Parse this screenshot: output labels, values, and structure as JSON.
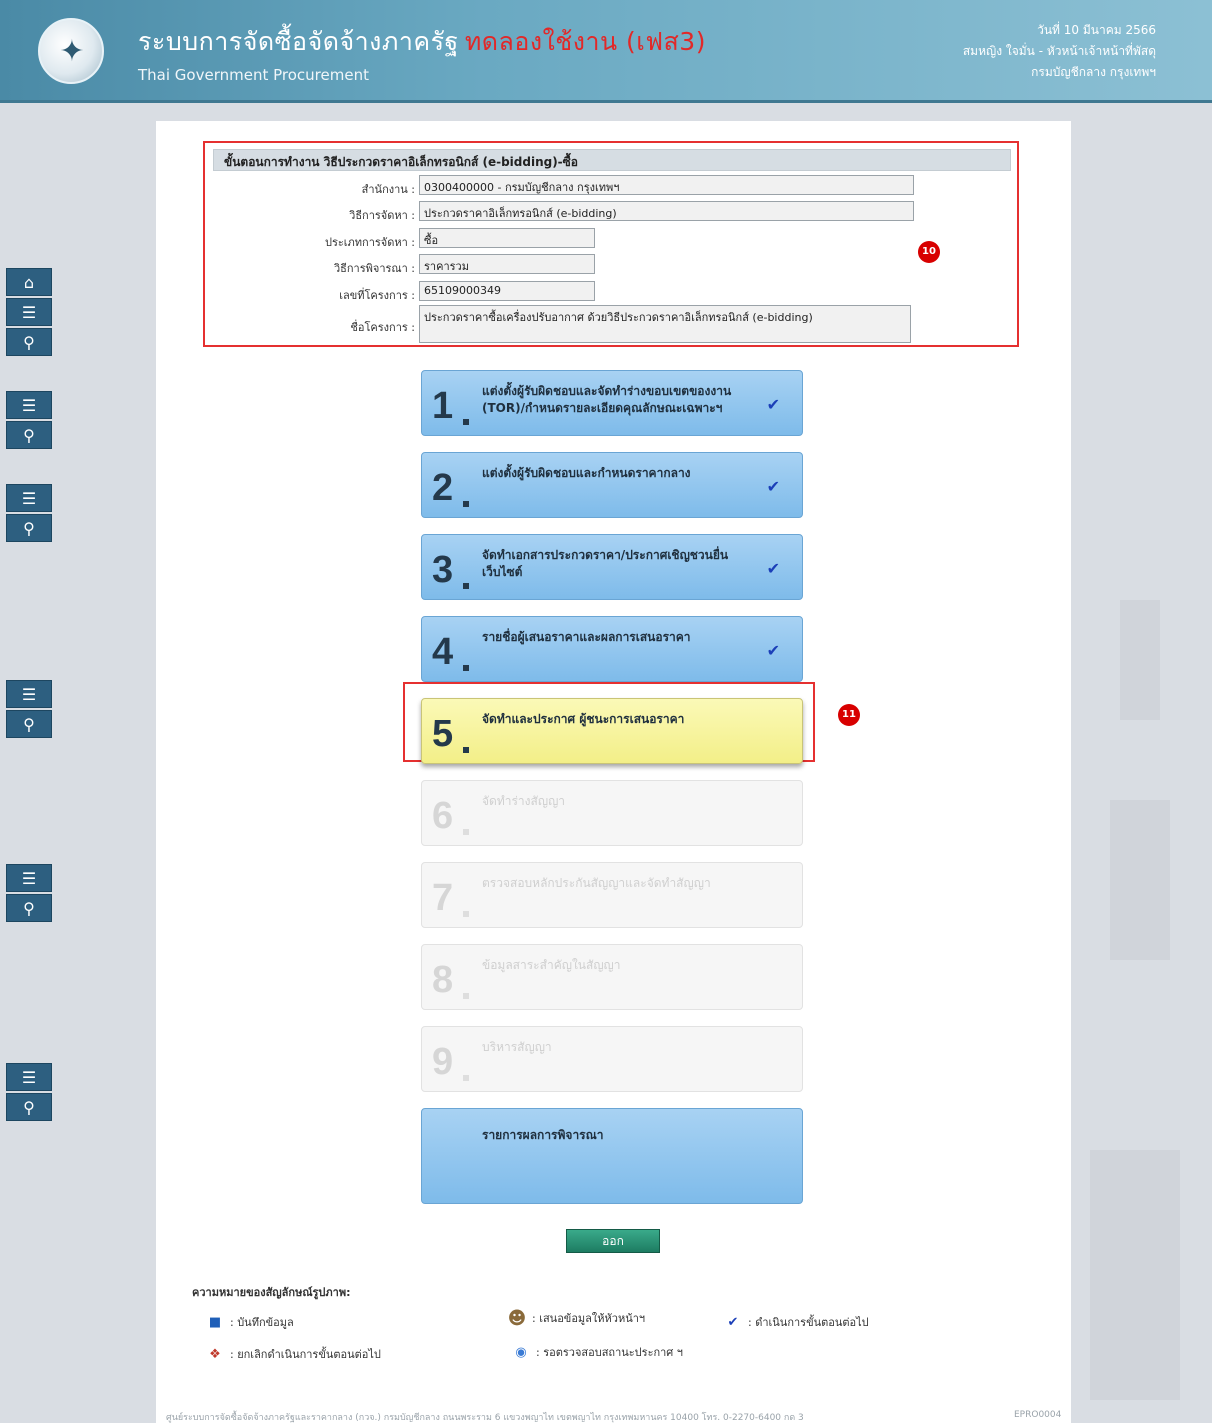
{
  "header": {
    "title": "ระบบการจัดซื้อจัดจ้างภาครัฐ",
    "trial_label": "ทดลองใช้งาน (เฟส3)",
    "subtitle": "Thai Government Procurement",
    "date": "วันที่ 10 มีนาคม 2566",
    "user": "สมหญิง ใจมั่น - หัวหน้าเจ้าหน้าที่พัสดุ",
    "department": "กรมบัญชีกลาง กรุงเทพฯ"
  },
  "info": {
    "header": "ขั้นตอนการทำงาน วิธีประกวดราคาอิเล็กทรอนิกส์ (e-bidding)-ซื้อ",
    "rows": [
      {
        "label": "สำนักงาน :",
        "value": "0300400000 - กรมบัญชีกลาง กรุงเทพฯ"
      },
      {
        "label": "วิธีการจัดหา :",
        "value": "ประกวดราคาอิเล็กทรอนิกส์ (e-bidding)"
      },
      {
        "label": "ประเภทการจัดหา :",
        "value": "ซื้อ"
      },
      {
        "label": "วิธีการพิจารณา :",
        "value": "ราคารวม"
      },
      {
        "label": "เลขที่โครงการ :",
        "value": "65109000349"
      },
      {
        "label": "ชื่อโครงการ :",
        "value": "ประกวดราคาซื้อเครื่องปรับอากาศ  ด้วยวิธีประกวดราคาอิเล็กทรอนิกส์ (e-bidding)"
      }
    ]
  },
  "markers": {
    "m10": "10",
    "m11": "11"
  },
  "steps": [
    {
      "num": "1",
      "label": "แต่งตั้งผู้รับผิดชอบและจัดทำร่างขอบเขตของงาน (TOR)/กำหนดรายละเอียดคุณลักษณะเฉพาะฯ",
      "check": "✔"
    },
    {
      "num": "2",
      "label": "แต่งตั้งผู้รับผิดชอบและกำหนดราคากลาง",
      "check": "✔"
    },
    {
      "num": "3",
      "label": "จัดทำเอกสารประกวดราคา/ประกาศเชิญชวนยื่นเว็บไซต์",
      "check": "✔"
    },
    {
      "num": "4",
      "label": "รายชื่อผู้เสนอราคาและผลการเสนอราคา",
      "check": "✔"
    },
    {
      "num": "5",
      "label": "จัดทำและประกาศ ผู้ชนะการเสนอราคา"
    },
    {
      "num": "6",
      "label": "จัดทำร่างสัญญา"
    },
    {
      "num": "7",
      "label": "ตรวจสอบหลักประกันสัญญาและจัดทำสัญญา"
    },
    {
      "num": "8",
      "label": "ข้อมูลสาระสำคัญในสัญญา"
    },
    {
      "num": "9",
      "label": "บริหารสัญญา"
    }
  ],
  "summary_label": "รายการผลการพิจารณา",
  "exit_label": "ออก",
  "legend": {
    "title": "ความหมายของสัญลักษณ์รูปภาพ:",
    "save": ": บันทึกข้อมูล",
    "propose": ": เสนอข้อมูลให้หัวหน้าฯ",
    "proceed": ": ดำเนินการขั้นตอนต่อไป",
    "cancel": ": ยกเลิกดำเนินการขั้นตอนต่อไป",
    "waiting": ": รอตรวจสอบสถานะประกาศ ฯ"
  },
  "footer": {
    "text": "ศูนย์ระบบการจัดซื้อจัดจ้างภาครัฐและราคากลาง (กวจ.) กรมบัญชีกลาง ถนนพระราม 6 แขวงพญาไท เขตพญาไท กรุงเทพมหานคร 10400 โทร. 0-2270-6400 กด 3",
    "code": "EPRO0004"
  },
  "colors": {
    "accent_red": "#e53030",
    "done_blue": "#7ebbea",
    "current_yellow": "#f3ef88"
  }
}
